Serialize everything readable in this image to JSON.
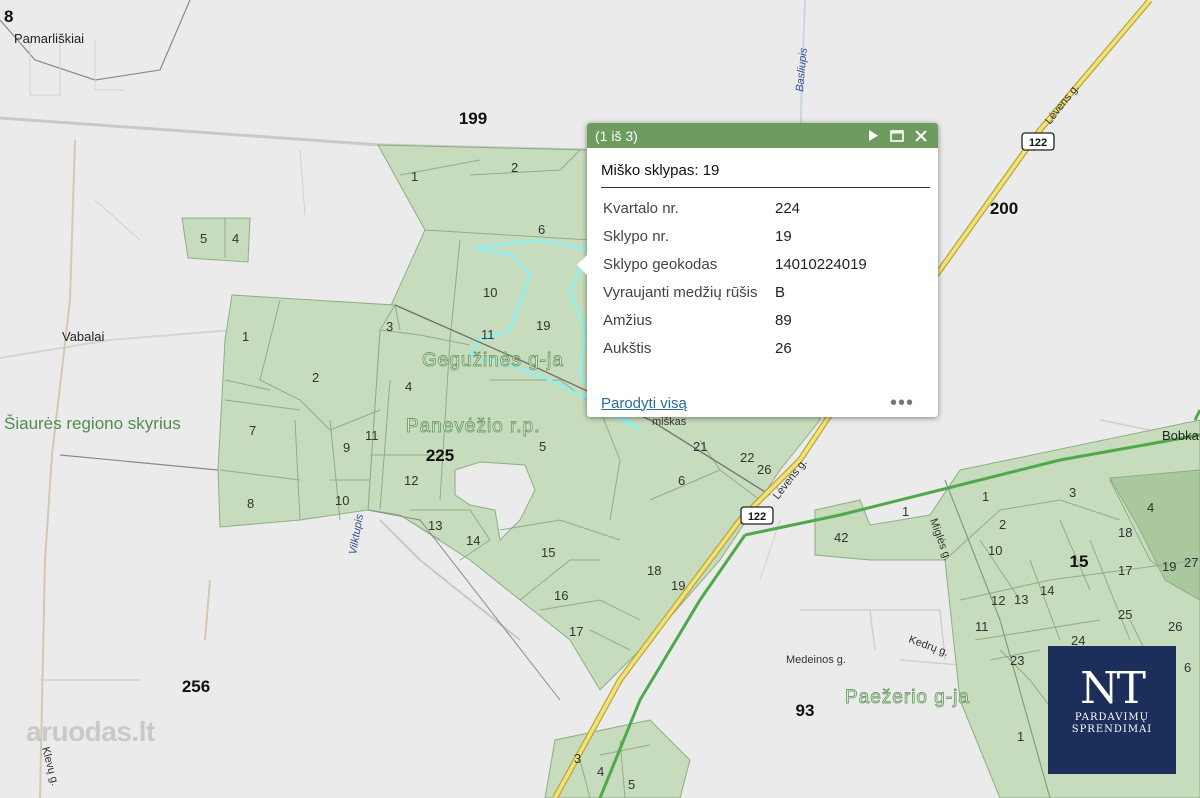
{
  "map": {
    "places": {
      "pamarliskiai": "Pamarliškiai",
      "vabalai": "Vabalai",
      "bobka": "Bobka",
      "top_left_num": "8"
    },
    "quarters": {
      "q199": "199",
      "q200": "200",
      "q225": "225",
      "q256": "256",
      "q93": "93",
      "q15": "15"
    },
    "regions": {
      "north": "Šiaurės regiono skyrius",
      "geguzines": "Gegužinės g-ja",
      "panevezio": "Panevėžio r.p.",
      "paezerio": "Paežerio g-ja"
    },
    "streets": {
      "levens_top": "Lėvens g.",
      "levens_mid": "Lėvens g.",
      "medeinos": "Medeinos g.",
      "kedru": "Kedrų g.",
      "miskas": "miškas",
      "migles": "Miglės g.",
      "klevu": "Klevų g."
    },
    "rivers": {
      "basliupis": "Basliupis",
      "vilktupis": "Vilktupis"
    },
    "road_shields": {
      "r1": "122",
      "r2": "122"
    },
    "parcels": {
      "p1": "1",
      "p2": "2",
      "p6": "6",
      "p5a": "5",
      "p4a": "4",
      "p10": "10",
      "p11": "11",
      "p19": "19",
      "p3": "3",
      "p1b": "1",
      "p2b": "2",
      "p4b": "4",
      "p7": "7",
      "p9": "9",
      "p11b": "11",
      "p8": "8",
      "p10b": "10",
      "p5b": "5",
      "p12": "12",
      "p13": "13",
      "p14": "14",
      "p15": "15",
      "p16": "16",
      "p17": "17",
      "p18": "18",
      "p19b": "19",
      "p6b": "6",
      "p21": "21",
      "p22": "22",
      "p26": "26",
      "e42": "42",
      "e1": "1",
      "e1b": "1",
      "e3": "3",
      "e2": "2",
      "e10": "10",
      "e18": "18",
      "e4": "4",
      "e27": "27",
      "e19": "19",
      "e17": "17",
      "e12": "12",
      "e13": "13",
      "e14": "14",
      "e25": "25",
      "e26": "26",
      "e11": "11",
      "e24": "24",
      "e23": "23",
      "e1c": "1",
      "e6": "6",
      "s3": "3",
      "s4": "4",
      "s5": "5"
    }
  },
  "popup": {
    "counter": "(1 iš 3)",
    "title": "Miško sklypas: 19",
    "fields": [
      {
        "key": "Kvartalo nr.",
        "value": "224"
      },
      {
        "key": "Sklypo nr.",
        "value": "19"
      },
      {
        "key": "Sklypo geokodas",
        "value": "14010224019"
      },
      {
        "key": "Vyraujanti medžių rūšis",
        "value": "B"
      },
      {
        "key": "Amžius",
        "value": "89"
      },
      {
        "key": "Aukštis",
        "value": "26"
      }
    ],
    "show_all": "Parodyti visą",
    "more": "•••"
  },
  "logos": {
    "nt_big": "NT",
    "nt_line1": "PARDAVIMŲ",
    "nt_line2": "SPRENDIMAI",
    "aruodas": "aruodas.lt"
  },
  "colors": {
    "forest": "#c6dcbc",
    "forest_dark": "#a9c89d",
    "road": "#e7d66b",
    "rail": "#4fa84c",
    "highlight": "#8ef0f0"
  }
}
